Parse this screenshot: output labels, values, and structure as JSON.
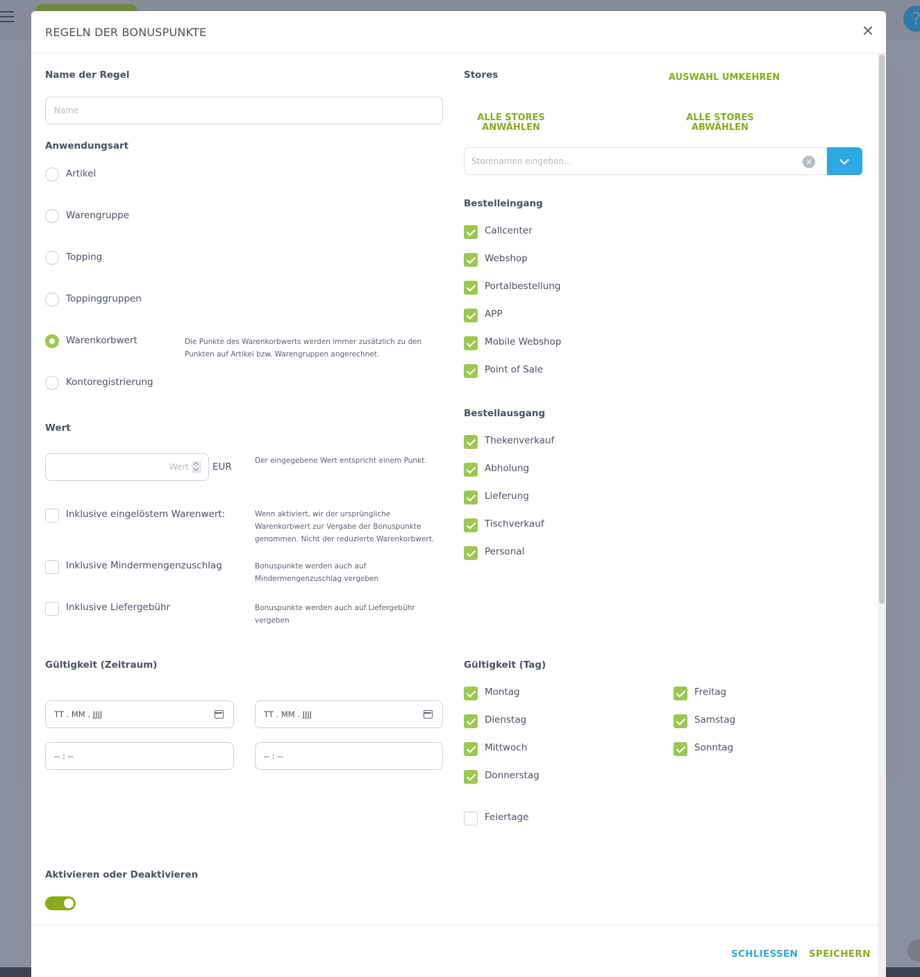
{
  "background": {
    "help_icon": "question-icon"
  },
  "modal": {
    "title": "REGELN DER BONUSPUNKTE",
    "close_icon": "close-icon"
  },
  "rule_name": {
    "label": "Name der Regel",
    "placeholder": "Name",
    "value": ""
  },
  "application_type": {
    "label": "Anwendungsart",
    "options": [
      {
        "label": "Artikel",
        "selected": false
      },
      {
        "label": "Warengruppe",
        "selected": false
      },
      {
        "label": "Topping",
        "selected": false
      },
      {
        "label": "Toppinggruppen",
        "selected": false
      },
      {
        "label": "Warenkorbwert",
        "selected": true
      },
      {
        "label": "Kontoregistrierung",
        "selected": false
      }
    ],
    "note": "Die Punkte des Warenkorbwerts werden immer zusätzlich zu den Punkten auf Artikel bzw. Warengruppen angerechnet."
  },
  "value": {
    "label": "Wert",
    "placeholder": "Wert",
    "currency": "EUR",
    "note": "Der eingegebene Wert entspricht einem Punkt."
  },
  "includes": [
    {
      "label": "Inklusive eingelöstem Warenwert:",
      "checked": false,
      "note": "Wenn aktiviert, wir der ursprüngliche Warenkorbwert zur Vergabe der Bonuspunkte genommen. Nicht der reduzierte Warenkorbwert."
    },
    {
      "label": "Inklusive Mindermengenzuschlag",
      "checked": false,
      "note": "Bonuspunkte werden auch auf Mindermengenzuschlag vergeben"
    },
    {
      "label": "Inklusive Liefergebühr",
      "checked": false,
      "note": "Bonuspunkte werden auch auf Liefergebühr vergeben"
    }
  ],
  "stores": {
    "label": "Stores",
    "invert_label": "AUSWAHL UMKEHREN",
    "select_all_label": "ALLE STORES ANWÄHLEN",
    "deselect_all_label": "ALLE STORES ABWÄHLEN",
    "search_placeholder": "Storenamen eingeben...",
    "clear_icon": "clear-icon",
    "dropdown_icon": "chevron-down-icon"
  },
  "order_input": {
    "label": "Bestelleingang",
    "items": [
      {
        "label": "Callcenter",
        "checked": true
      },
      {
        "label": "Webshop",
        "checked": true
      },
      {
        "label": "Portalbestellung",
        "checked": true
      },
      {
        "label": "APP",
        "checked": true
      },
      {
        "label": "Mobile Webshop",
        "checked": true
      },
      {
        "label": "Point of Sale",
        "checked": true
      }
    ]
  },
  "order_output": {
    "label": "Bestellausgang",
    "items": [
      {
        "label": "Thekenverkauf",
        "checked": true
      },
      {
        "label": "Abholung",
        "checked": true
      },
      {
        "label": "Lieferung",
        "checked": true
      },
      {
        "label": "Tischverkauf",
        "checked": true
      },
      {
        "label": "Personal",
        "checked": true
      }
    ]
  },
  "validity_period": {
    "label": "Gültigkeit (Zeitraum)",
    "start_date": "TT . MM . JJJJ",
    "end_date": "TT . MM . JJJJ",
    "start_time": "-- : --",
    "end_time": "-- : --",
    "calendar_icon": "calendar-icon"
  },
  "validity_day": {
    "label": "Gültigkeit (Tag)",
    "days": [
      {
        "label": "Montag",
        "checked": true
      },
      {
        "label": "Dienstag",
        "checked": true
      },
      {
        "label": "Mittwoch",
        "checked": true
      },
      {
        "label": "Donnerstag",
        "checked": true
      },
      {
        "label": "Freitag",
        "checked": true
      },
      {
        "label": "Samstag",
        "checked": true
      },
      {
        "label": "Sonntag",
        "checked": true
      }
    ],
    "holidays": {
      "label": "Feiertage",
      "checked": false
    }
  },
  "activation": {
    "label": "Aktivieren oder Deaktivieren",
    "enabled": true
  },
  "footer": {
    "close_label": "SCHLIESSEN",
    "save_label": "SPEICHERN"
  },
  "colors": {
    "accent_green": "#8aaa1e",
    "check_green": "#9cc84f",
    "close_blue": "#2ea8e0"
  }
}
